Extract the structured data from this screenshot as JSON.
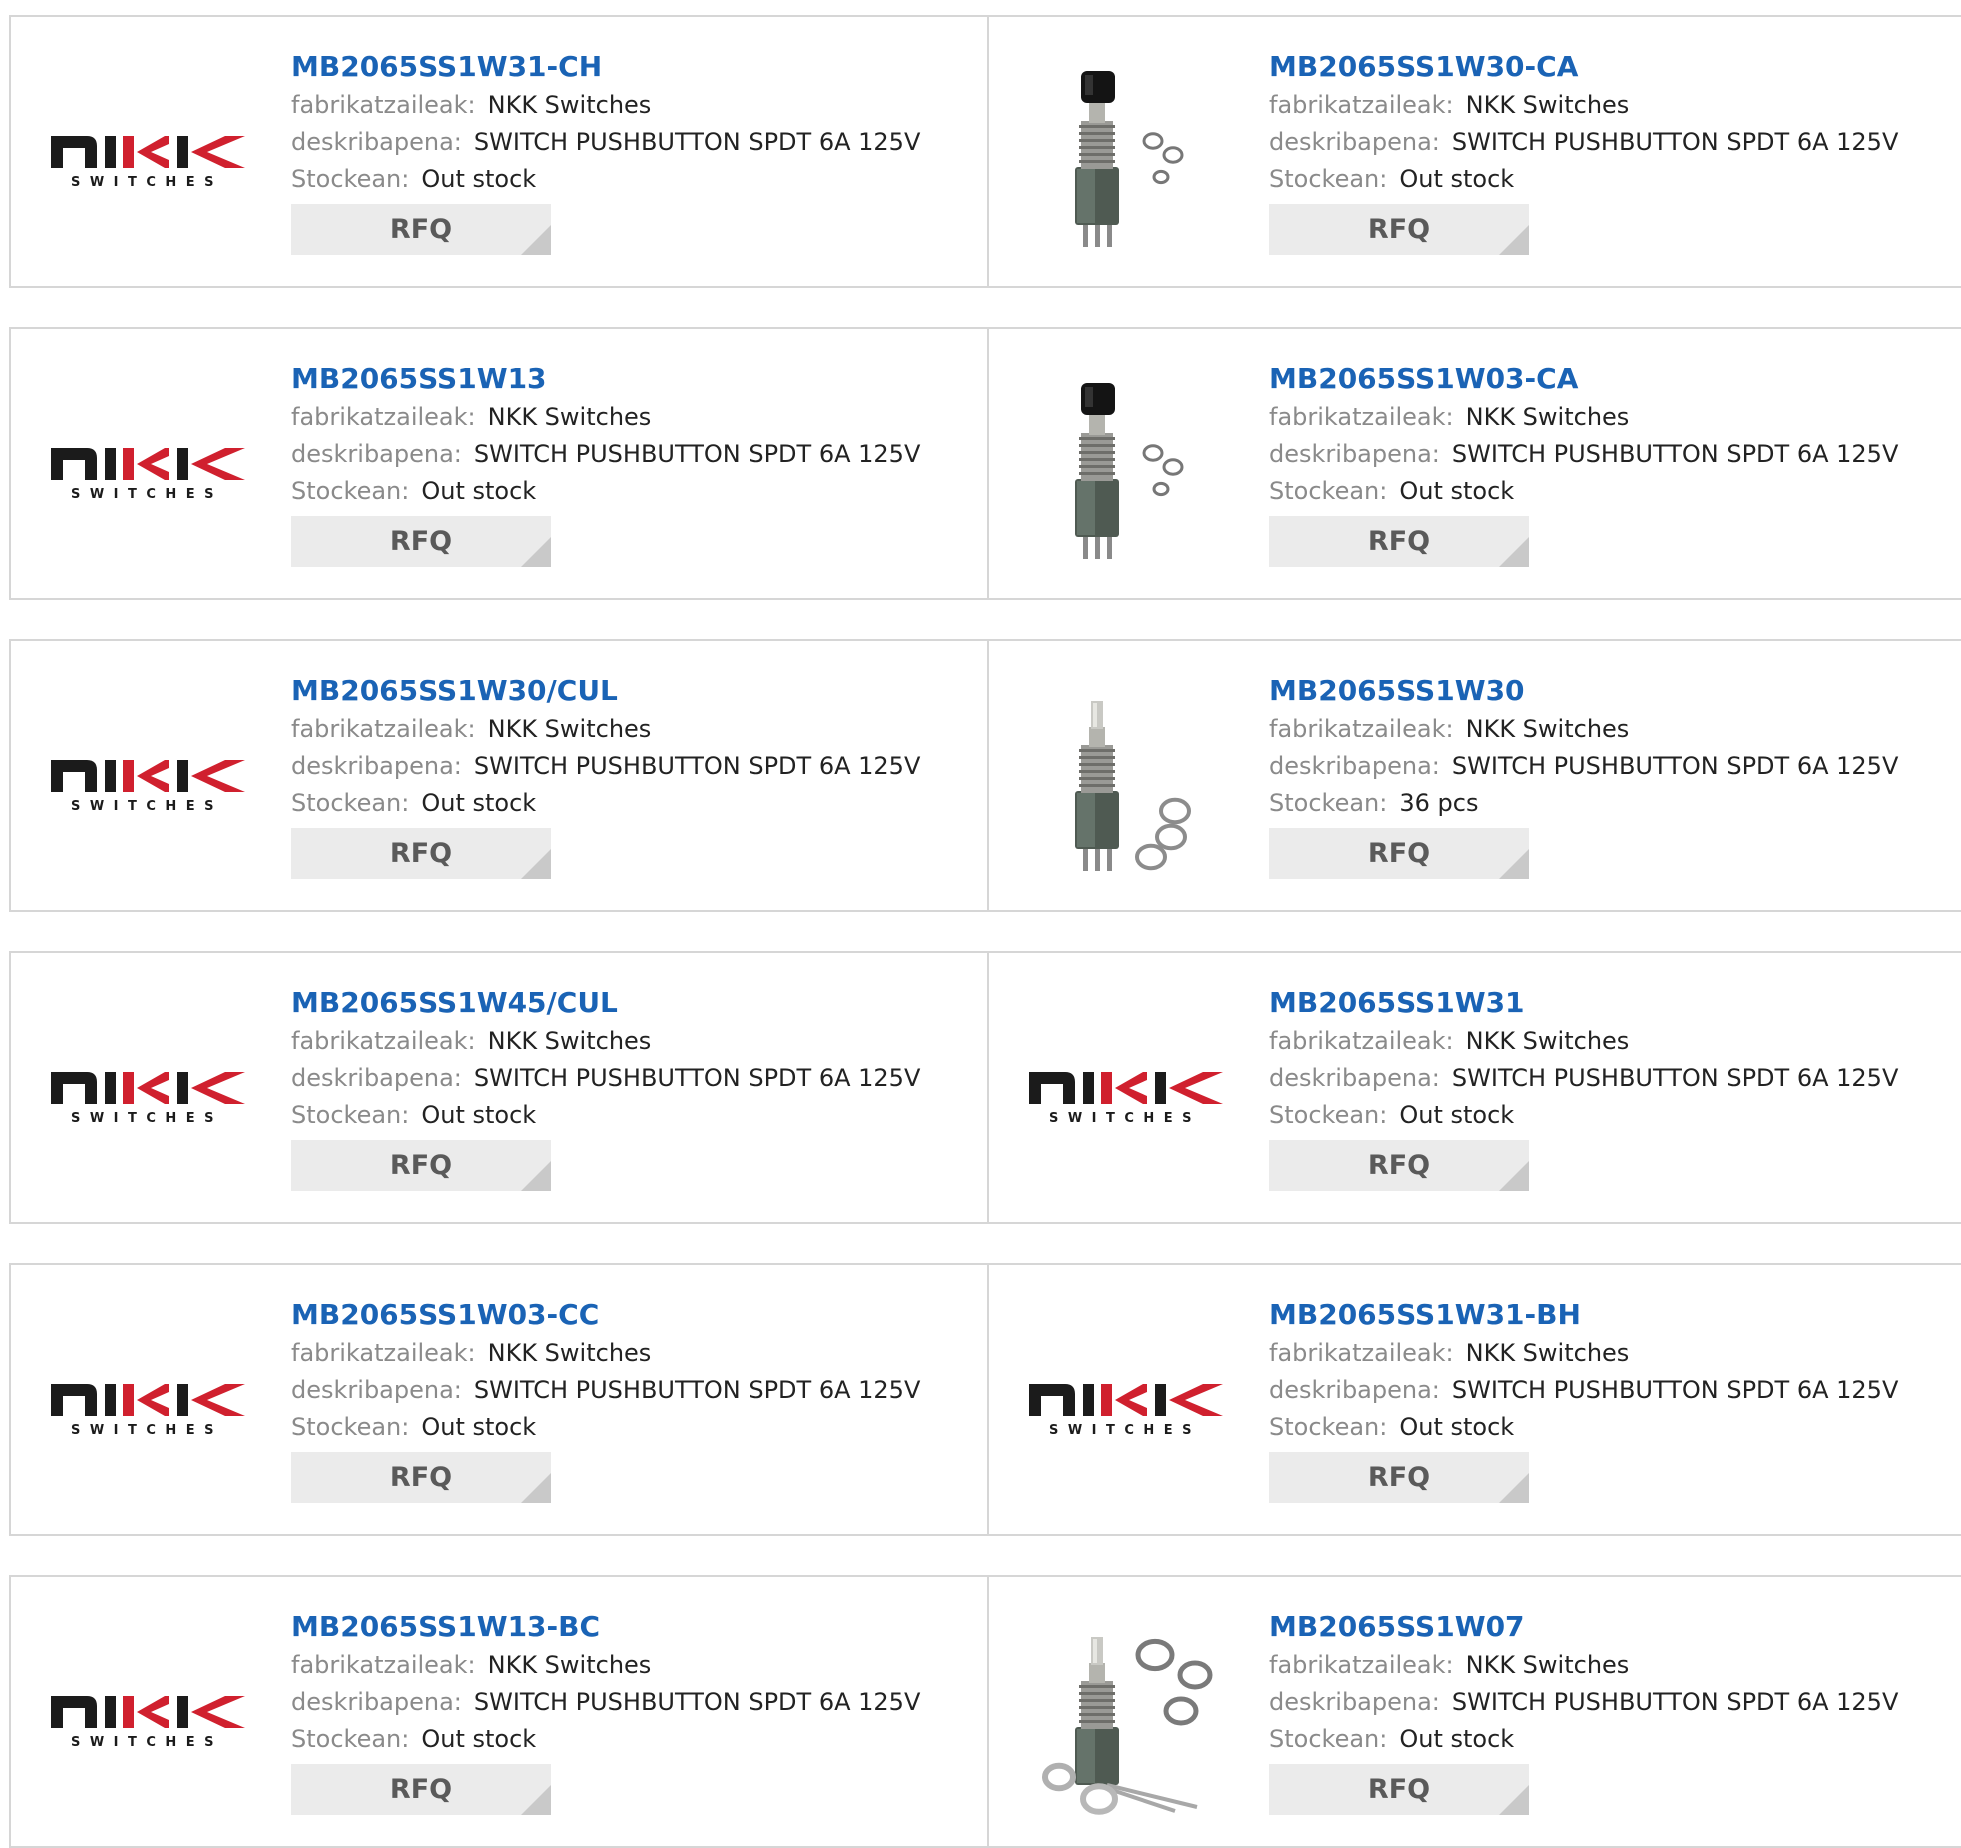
{
  "labels": {
    "manufacturer": "fabrikatzaileak:",
    "description": "deskribapena:",
    "stock": "Stockean:",
    "rfq": "RFQ"
  },
  "logo": {
    "brand": "NIKK",
    "subtitle": "SWITCHES"
  },
  "colors": {
    "part_link": "#1a63b5",
    "border": "#d6d6d6",
    "rfq_bg": "#ebebeb",
    "logo_red": "#d0202e"
  },
  "products": [
    {
      "part": "MB2065SS1W31-CH",
      "manufacturer": "NKK Switches",
      "description": "SWITCH PUSHBUTTON SPDT 6A 125V",
      "stock": "Out stock",
      "image": "nkk-logo"
    },
    {
      "part": "MB2065SS1W30-CA",
      "manufacturer": "NKK Switches",
      "description": "SWITCH PUSHBUTTON SPDT 6A 125V",
      "stock": "Out stock",
      "image": "pushbutton-black-cap"
    },
    {
      "part": "MB2065SS1W13",
      "manufacturer": "NKK Switches",
      "description": "SWITCH PUSHBUTTON SPDT 6A 125V",
      "stock": "Out stock",
      "image": "nkk-logo"
    },
    {
      "part": "MB2065SS1W03-CA",
      "manufacturer": "NKK Switches",
      "description": "SWITCH PUSHBUTTON SPDT 6A 125V",
      "stock": "Out stock",
      "image": "pushbutton-black-cap"
    },
    {
      "part": "MB2065SS1W30/CUL",
      "manufacturer": "NKK Switches",
      "description": "SWITCH PUSHBUTTON SPDT 6A 125V",
      "stock": "Out stock",
      "image": "nkk-logo"
    },
    {
      "part": "MB2065SS1W30",
      "manufacturer": "NKK Switches",
      "description": "SWITCH PUSHBUTTON SPDT 6A 125V",
      "stock": "36 pcs",
      "image": "pushbutton-bare"
    },
    {
      "part": "MB2065SS1W45/CUL",
      "manufacturer": "NKK Switches",
      "description": "SWITCH PUSHBUTTON SPDT 6A 125V",
      "stock": "Out stock",
      "image": "nkk-logo"
    },
    {
      "part": "MB2065SS1W31",
      "manufacturer": "NKK Switches",
      "description": "SWITCH PUSHBUTTON SPDT 6A 125V",
      "stock": "Out stock",
      "image": "nkk-logo"
    },
    {
      "part": "MB2065SS1W03-CC",
      "manufacturer": "NKK Switches",
      "description": "SWITCH PUSHBUTTON SPDT 6A 125V",
      "stock": "Out stock",
      "image": "nkk-logo"
    },
    {
      "part": "MB2065SS1W31-BH",
      "manufacturer": "NKK Switches",
      "description": "SWITCH PUSHBUTTON SPDT 6A 125V",
      "stock": "Out stock",
      "image": "nkk-logo"
    },
    {
      "part": "MB2065SS1W13-BC",
      "manufacturer": "NKK Switches",
      "description": "SWITCH PUSHBUTTON SPDT 6A 125V",
      "stock": "Out stock",
      "image": "nkk-logo"
    },
    {
      "part": "MB2065SS1W07",
      "manufacturer": "NKK Switches",
      "description": "SWITCH PUSHBUTTON SPDT 6A 125V",
      "stock": "Out stock",
      "image": "pushbutton-long-pins"
    }
  ]
}
